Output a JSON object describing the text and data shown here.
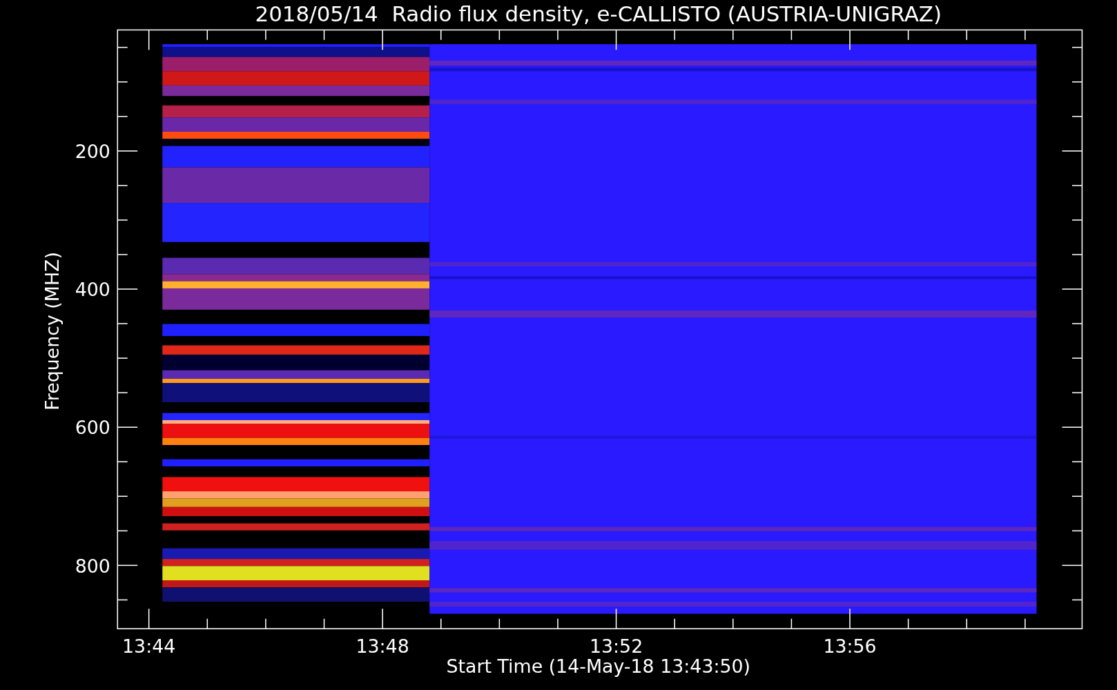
{
  "title": "2018/05/14  Radio flux density, e-CALLISTO (AUSTRIA-UNIGRAZ)",
  "y_axis": {
    "label": "Frequency (MHZ)",
    "ticks": [
      "200",
      "400",
      "600",
      "800"
    ]
  },
  "x_axis": {
    "label": "Start Time (14-May-18 13:43:50)",
    "ticks": [
      "13:44",
      "13:48",
      "13:52",
      "13:56"
    ]
  }
}
